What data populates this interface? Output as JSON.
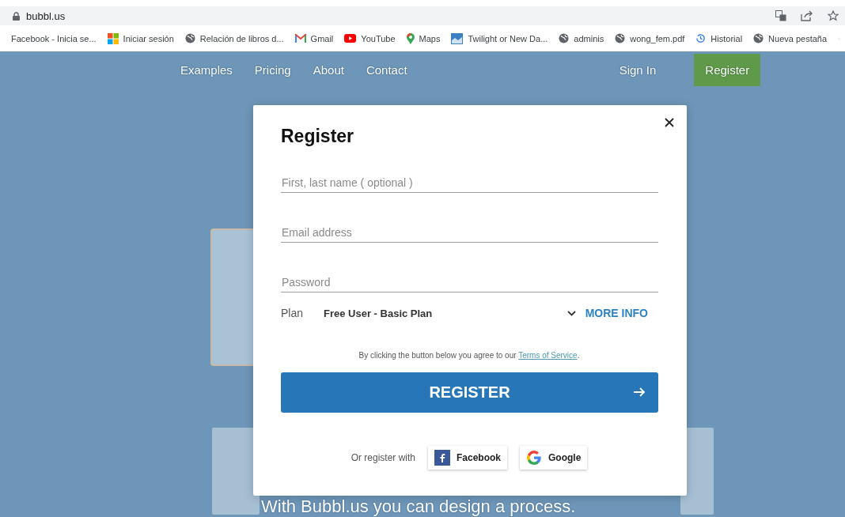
{
  "browser": {
    "address": "bubbl.us"
  },
  "bookmarks": [
    {
      "label": "Facebook - Inicia se...",
      "kind": "none"
    },
    {
      "label": "Iniciar sesión",
      "kind": "windows"
    },
    {
      "label": "Relación de libros d...",
      "kind": "globe"
    },
    {
      "label": "Gmail",
      "kind": "gmail"
    },
    {
      "label": "YouTube",
      "kind": "youtube"
    },
    {
      "label": "Maps",
      "kind": "maps"
    },
    {
      "label": "Twilight or New Da...",
      "kind": "image"
    },
    {
      "label": "adminis",
      "kind": "globe"
    },
    {
      "label": "wong_fem.pdf",
      "kind": "globe"
    },
    {
      "label": "Historial",
      "kind": "history"
    },
    {
      "label": "Nueva pestaña",
      "kind": "globe"
    }
  ],
  "nav": {
    "left": [
      "Examples",
      "Pricing",
      "About",
      "Contact"
    ],
    "sign_in": "Sign In",
    "register": "Register"
  },
  "background_text": "With Bubbl.us you can  design a process.",
  "dialog": {
    "title": "Register",
    "fields": [
      {
        "placeholder": "First, last name ( optional )"
      },
      {
        "placeholder": "Email address"
      },
      {
        "placeholder": "Password"
      }
    ],
    "plan": {
      "label": "Plan",
      "value": "Free User - Basic Plan",
      "more": "MORE INFO"
    },
    "terms": {
      "text": "By clicking the button below you agree to our",
      "link": "Terms of Service",
      "after": "."
    },
    "submit": "REGISTER",
    "social": {
      "label": "Or register with",
      "buttons": [
        {
          "label": "Facebook",
          "kind": "facebook"
        },
        {
          "label": "Google",
          "kind": "google"
        }
      ]
    }
  }
}
